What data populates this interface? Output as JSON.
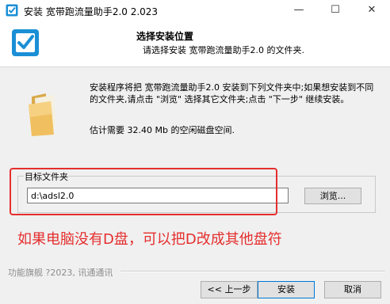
{
  "window": {
    "title": "安装 宽带跑流量助手2.0 2.023",
    "minimize_glyph": "—",
    "maximize_glyph": "☐",
    "close_glyph": "✕"
  },
  "header": {
    "title": "选择安装位置",
    "subtitle": "请选择安装 宽带跑流量助手2.0 的文件夹."
  },
  "body": {
    "description": "安装程序将把 宽带跑流量助手2.0 安装到下列文件夹中;如果想安装到不同的文件夹,请点击 \"浏览\" 选择其它文件夹;点击 \"下一步\" 继续安装。",
    "space_required": "估计需要 32.40 Mb 的空闲磁盘空间."
  },
  "destination": {
    "group_label": "目标文件夹",
    "path_value": "d:\\adsl2.0",
    "browse_label": "浏览..."
  },
  "annotation": "如果电脑没有D盘，可以把D改成其他盘符",
  "footer": {
    "brand": "功能旗舰 ?2023, 讯通通讯",
    "back_label": "<< 上一步",
    "install_label": "安装",
    "cancel_label": "取消"
  },
  "colors": {
    "accent": "#0078d7",
    "annotation_red": "#e52e2e",
    "folder": "#f0c060"
  },
  "icons": {
    "app": "checkbox-icon",
    "header": "checkbox-icon",
    "folder": "folder-icon"
  }
}
